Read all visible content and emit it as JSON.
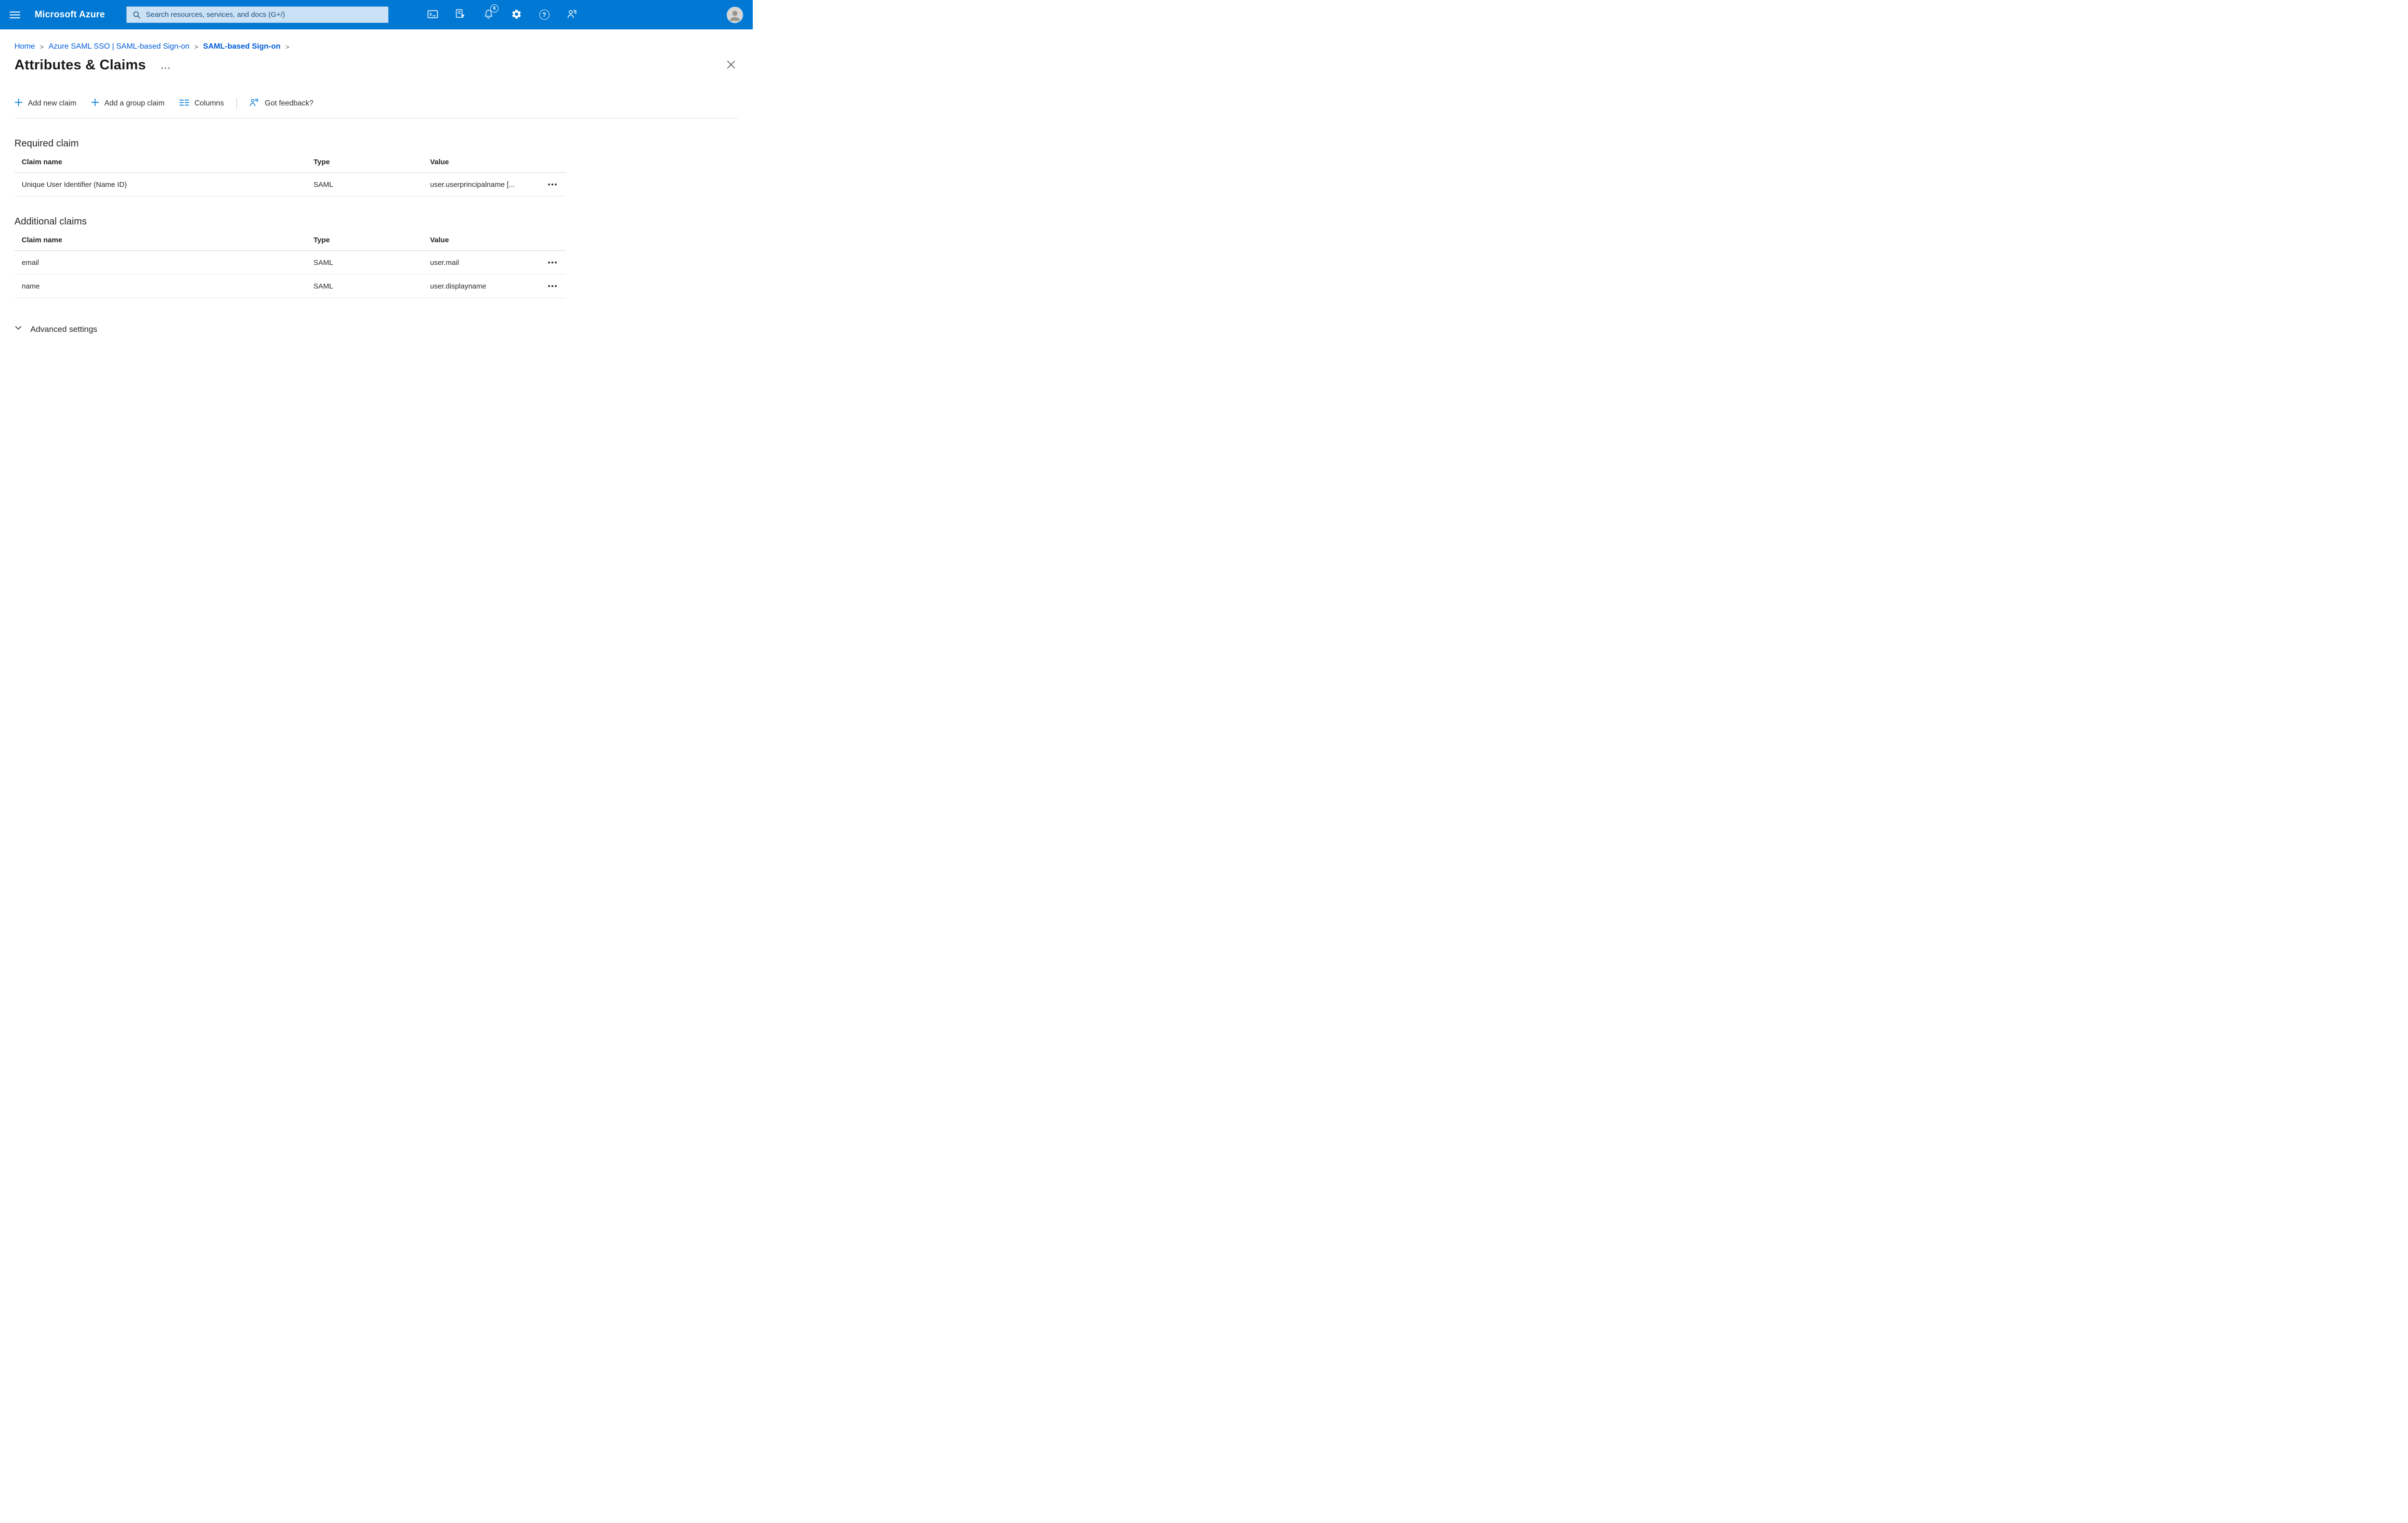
{
  "colors": {
    "topbar": "#0078d4",
    "accent": "#0078d4",
    "link": "#015cda",
    "search_background": "#cbe2f6",
    "text": "#323130"
  },
  "topbar": {
    "brand": "Microsoft Azure",
    "search_placeholder": "Search resources, services, and docs (G+/)",
    "notification_count": "6"
  },
  "breadcrumb": {
    "separator": ">",
    "items": [
      "Home",
      "Azure SAML SSO | SAML-based Sign-on",
      "SAML-based Sign-on"
    ]
  },
  "page": {
    "title": "Attributes & Claims"
  },
  "toolbar": {
    "items": [
      "Add new claim",
      "Add a group claim",
      "Columns",
      "Got feedback?"
    ]
  },
  "required_claim": {
    "heading": "Required claim",
    "columns": [
      "Claim name",
      "Type",
      "Value"
    ],
    "rows": [
      {
        "claim_name": "Unique User Identifier (Name ID)",
        "type": "SAML",
        "value": "user.userprincipalname [..."
      }
    ]
  },
  "additional_claims": {
    "heading": "Additional claims",
    "columns": [
      "Claim name",
      "Type",
      "Value"
    ],
    "rows": [
      {
        "claim_name": "email",
        "type": "SAML",
        "value": "user.mail"
      },
      {
        "claim_name": "name",
        "type": "SAML",
        "value": "user.displayname"
      }
    ]
  },
  "advanced_settings": {
    "label": "Advanced settings"
  },
  "icons": [
    "hamburger-icon",
    "search-icon",
    "cloud-shell-icon",
    "directory-filter-icon",
    "bell-icon",
    "gear-icon",
    "help-icon",
    "feedback-icon",
    "avatar",
    "plus-icon",
    "columns-icon",
    "divider",
    "ellipsis-icon",
    "close-icon",
    "chevron-down-icon",
    "breadcrumb-separator"
  ]
}
